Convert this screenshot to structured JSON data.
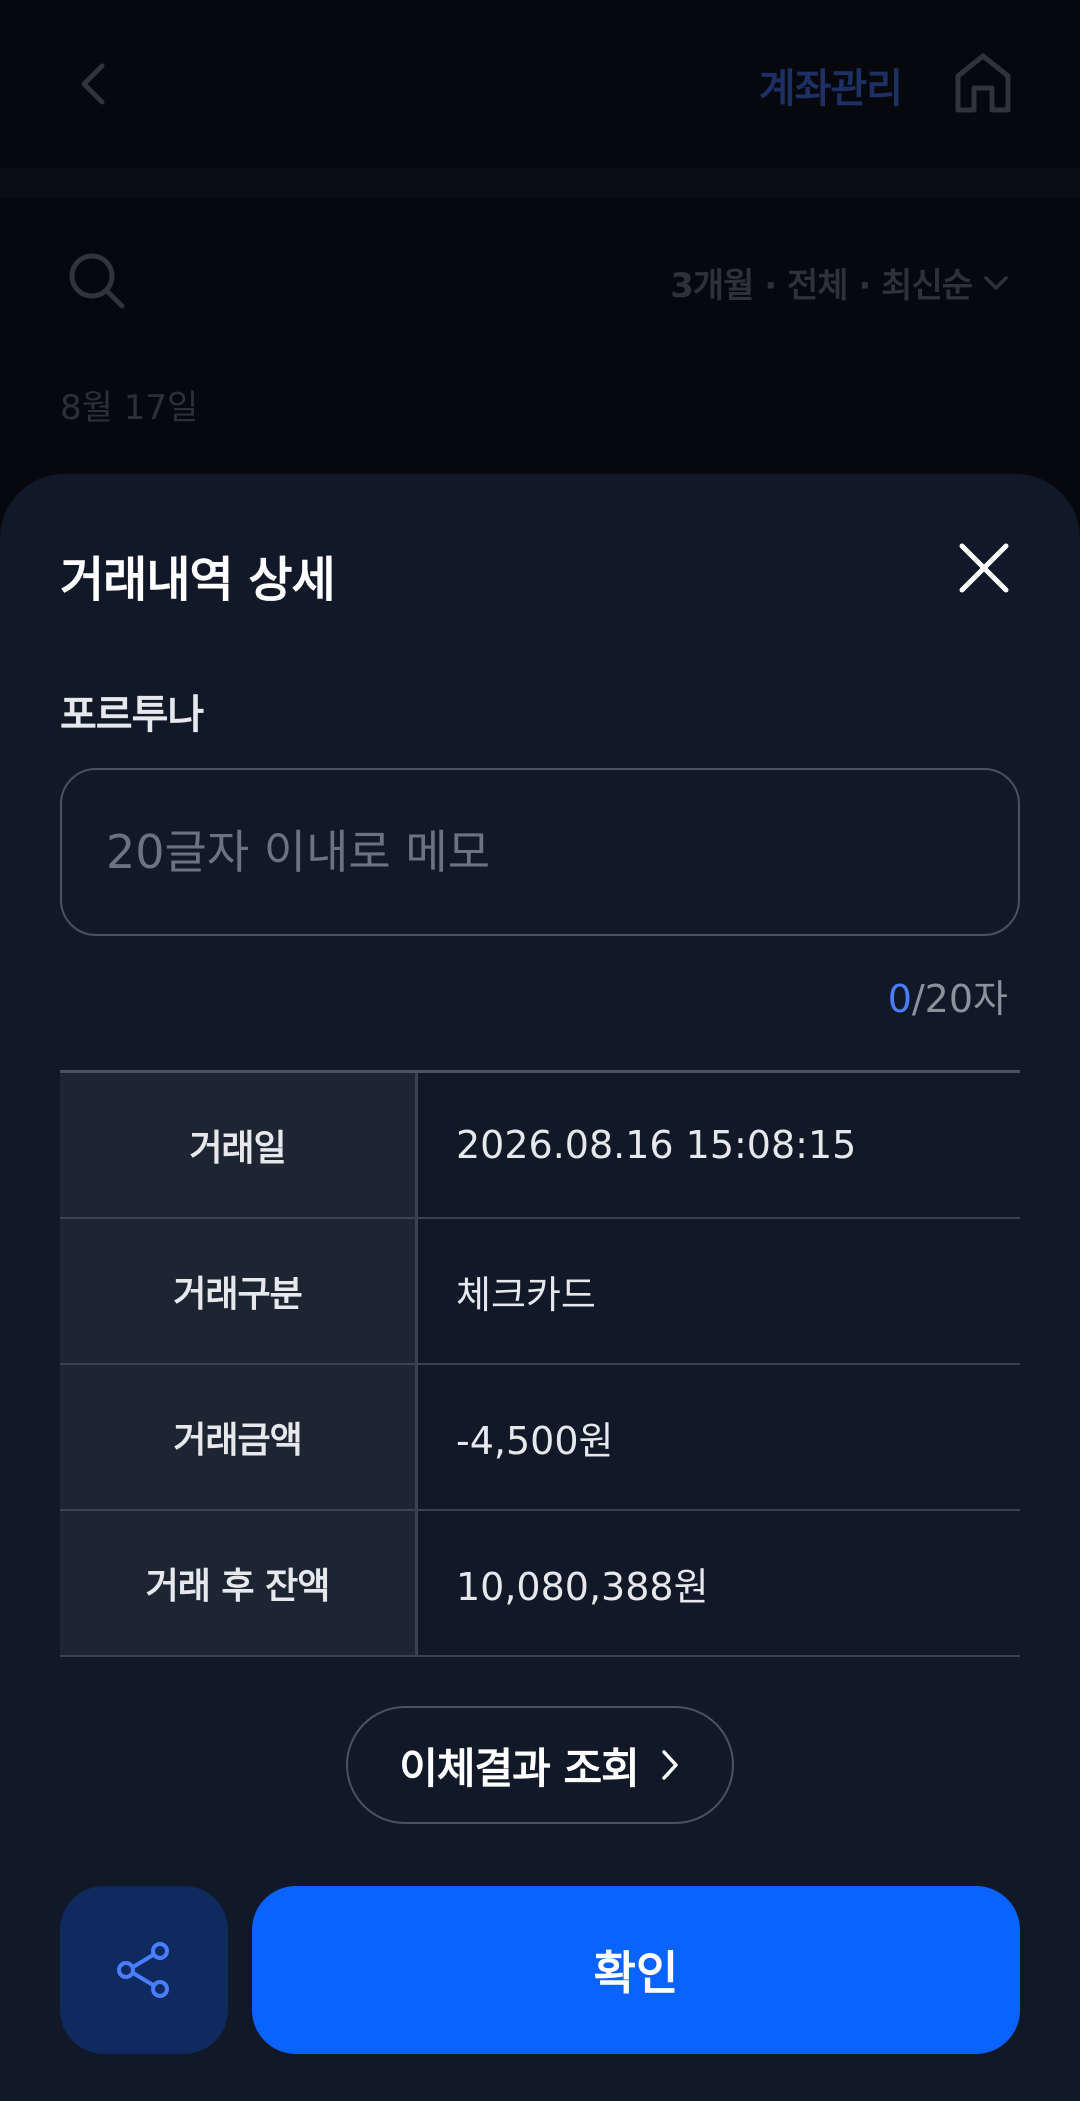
{
  "background": {
    "header_title": "계좌관리",
    "filter_label": "3개월 · 전체 · 최신순",
    "date_label": "8월 17일"
  },
  "sheet": {
    "title": "거래내역 상세",
    "merchant": "포르투나",
    "memo": {
      "value": "",
      "placeholder": "20글자 이내로 메모",
      "count_current": "0",
      "count_max": "/20자"
    },
    "details": [
      {
        "label": "거래일",
        "value": "2026.08.16 15:08:15"
      },
      {
        "label": "거래구분",
        "value": "체크카드"
      },
      {
        "label": "거래금액",
        "value": "-4,500원"
      },
      {
        "label": "거래 후 잔액",
        "value": "10,080,388원"
      }
    ],
    "result_button_label": "이체결과 조회",
    "confirm_label": "확인"
  },
  "colors": {
    "accent": "#0a63ff",
    "sheet_bg": "#111827",
    "share_bg": "#0e2a5e"
  },
  "icons": [
    "back-icon",
    "home-icon",
    "search-icon",
    "chevron-down-icon",
    "close-icon",
    "chevron-right-icon",
    "share-icon"
  ]
}
